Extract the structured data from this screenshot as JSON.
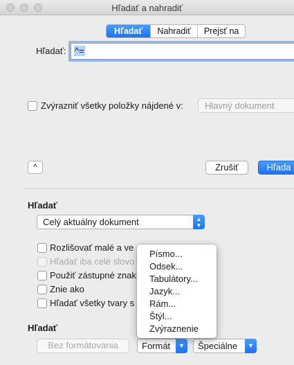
{
  "window": {
    "title": "Hľadať a nahradiť"
  },
  "tabs": [
    {
      "label": "Hľadať",
      "active": true
    },
    {
      "label": "Nahradiť",
      "active": false
    },
    {
      "label": "Prejsť na",
      "active": false
    }
  ],
  "find": {
    "label": "Hľadať:",
    "value": "^="
  },
  "highlight": {
    "label": "Zvýrazniť všetky položky nájdené v:",
    "popup_value": "Hlavný dokument"
  },
  "buttons": {
    "collapse": "^",
    "cancel": "Zrušiť",
    "find": "Hľada"
  },
  "search_section": {
    "title": "Hľadať",
    "scope_value": "Celý aktuálny dokument"
  },
  "options": [
    {
      "label": "Rozlišovať malé a ve",
      "enabled": true
    },
    {
      "label": "Hľadať iba celé slovo",
      "enabled": false
    },
    {
      "label": "Použiť zástupné znak",
      "enabled": true
    },
    {
      "label": "Znie ako",
      "enabled": true
    },
    {
      "label": "Hľadať všetky tvary s",
      "enabled": true
    }
  ],
  "format_section": {
    "title": "Hľadať",
    "no_format": "Bez formátovania",
    "format": "Formát",
    "special": "Špeciálne"
  },
  "format_menu": [
    "Písmo...",
    "Odsek...",
    "Tabulátory...",
    "Jazyk...",
    "Rám...",
    "Štýl...",
    "Zvýraznenie"
  ],
  "colors": {
    "accent": "#1a74f2",
    "background": "#ececec"
  }
}
